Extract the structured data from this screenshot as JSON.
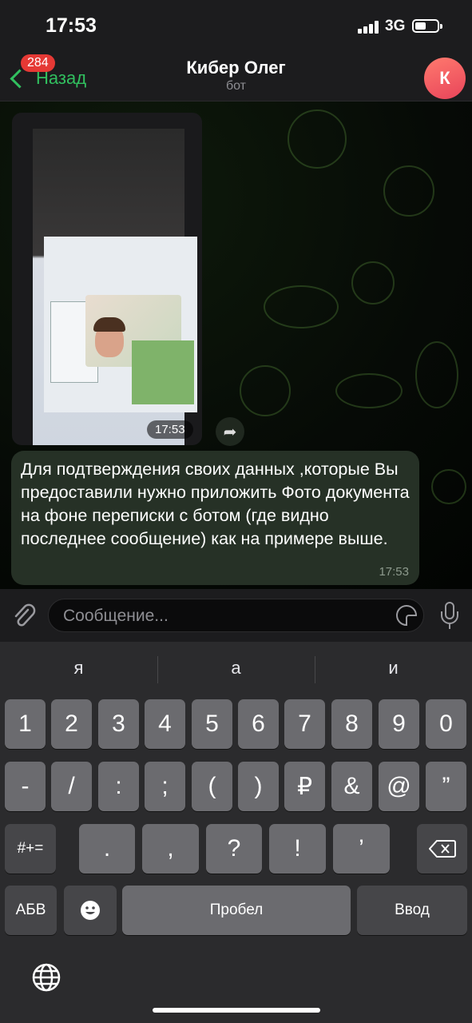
{
  "status_bar": {
    "time": "17:53",
    "network": "3G"
  },
  "nav": {
    "back_label": "Назад",
    "unread_badge": "284",
    "title": "Кибер Олег",
    "subtitle": "бот",
    "avatar_letter": "К",
    "accent_color": "#31c05f"
  },
  "chat": {
    "photo_message": {
      "time": "17:53"
    },
    "text_message": {
      "text": "Для подтверждения своих данных ,которые Вы предоставили  нужно приложить Фото документа на фоне переписки с ботом (где видно последнее сообщение)  как на примере выше.",
      "time": "17:53"
    }
  },
  "input": {
    "placeholder": "Сообщение..."
  },
  "keyboard": {
    "suggestions": [
      "я",
      "а",
      "и"
    ],
    "row1": [
      "1",
      "2",
      "3",
      "4",
      "5",
      "6",
      "7",
      "8",
      "9",
      "0"
    ],
    "row2": [
      "-",
      "/",
      ":",
      ";",
      "(",
      ")",
      "₽",
      "&",
      "@",
      "”"
    ],
    "row3_left": "#+=",
    "row3": [
      ".",
      ",",
      "?",
      "!",
      "’"
    ],
    "abc_label": "АБВ",
    "space_label": "Пробел",
    "return_label": "Ввод"
  }
}
